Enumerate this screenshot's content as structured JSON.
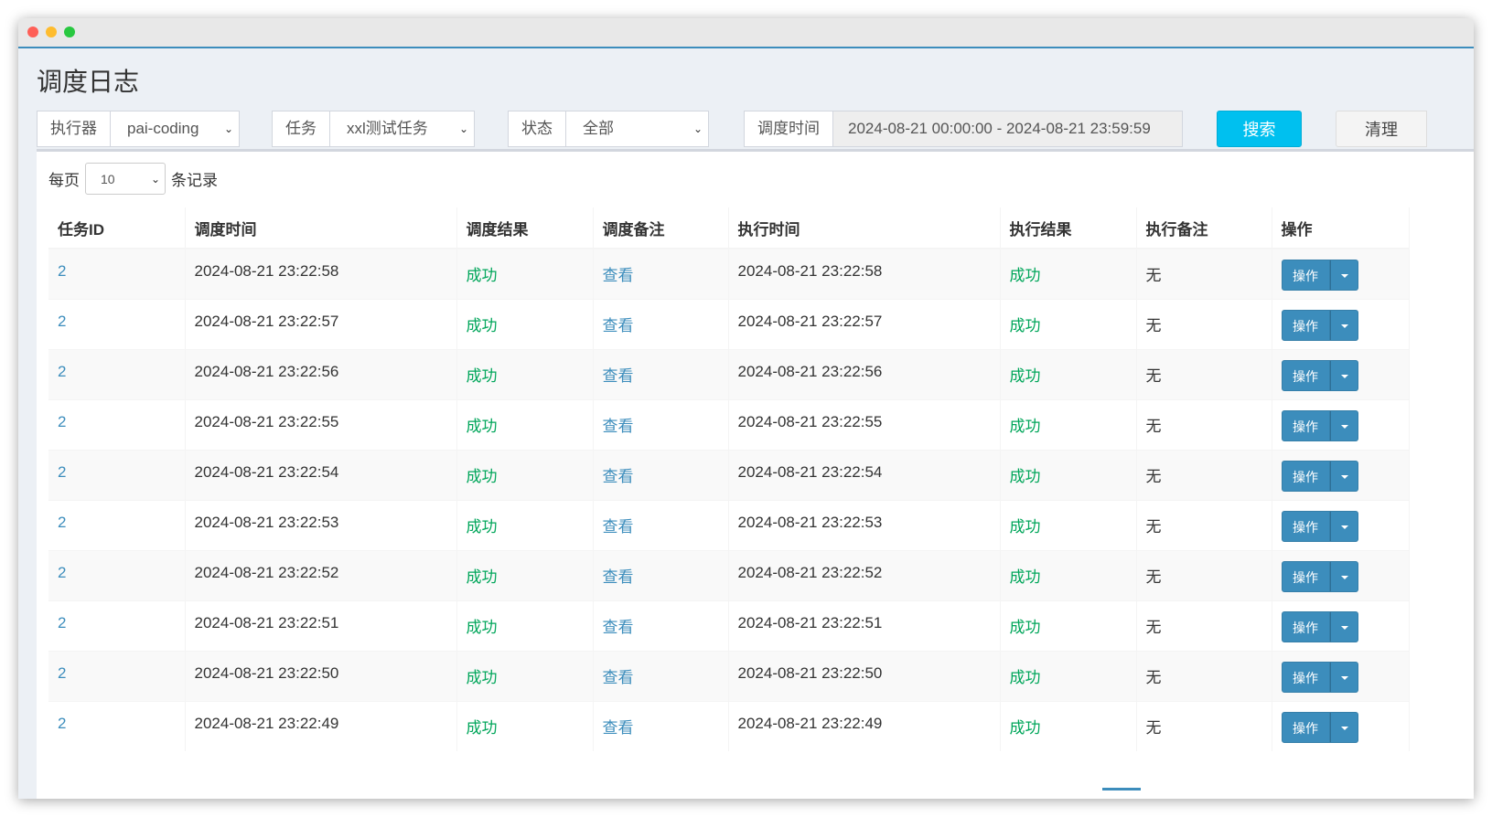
{
  "page": {
    "title": "调度日志"
  },
  "filters": {
    "executor_label": "执行器",
    "executor_value": "pai-coding",
    "job_label": "任务",
    "job_value": "xxl测试任务",
    "status_label": "状态",
    "status_value": "全部",
    "time_label": "调度时间",
    "time_value": "2024-08-21 00:00:00 - 2024-08-21 23:59:59",
    "search_label": "搜索",
    "clear_label": "清理"
  },
  "length": {
    "prefix": "每页",
    "value": "10",
    "suffix": "条记录"
  },
  "table": {
    "headers": [
      "任务ID",
      "调度时间",
      "调度结果",
      "调度备注",
      "执行时间",
      "执行结果",
      "执行备注",
      "操作"
    ],
    "rows": [
      {
        "job_id": "2",
        "trigger_time": "2024-08-21 23:22:58",
        "trigger_result": "成功",
        "trigger_note": "查看",
        "handle_time": "2024-08-21 23:22:58",
        "handle_result": "成功",
        "handle_note": "无",
        "op": "操作"
      },
      {
        "job_id": "2",
        "trigger_time": "2024-08-21 23:22:57",
        "trigger_result": "成功",
        "trigger_note": "查看",
        "handle_time": "2024-08-21 23:22:57",
        "handle_result": "成功",
        "handle_note": "无",
        "op": "操作"
      },
      {
        "job_id": "2",
        "trigger_time": "2024-08-21 23:22:56",
        "trigger_result": "成功",
        "trigger_note": "查看",
        "handle_time": "2024-08-21 23:22:56",
        "handle_result": "成功",
        "handle_note": "无",
        "op": "操作"
      },
      {
        "job_id": "2",
        "trigger_time": "2024-08-21 23:22:55",
        "trigger_result": "成功",
        "trigger_note": "查看",
        "handle_time": "2024-08-21 23:22:55",
        "handle_result": "成功",
        "handle_note": "无",
        "op": "操作"
      },
      {
        "job_id": "2",
        "trigger_time": "2024-08-21 23:22:54",
        "trigger_result": "成功",
        "trigger_note": "查看",
        "handle_time": "2024-08-21 23:22:54",
        "handle_result": "成功",
        "handle_note": "无",
        "op": "操作"
      },
      {
        "job_id": "2",
        "trigger_time": "2024-08-21 23:22:53",
        "trigger_result": "成功",
        "trigger_note": "查看",
        "handle_time": "2024-08-21 23:22:53",
        "handle_result": "成功",
        "handle_note": "无",
        "op": "操作"
      },
      {
        "job_id": "2",
        "trigger_time": "2024-08-21 23:22:52",
        "trigger_result": "成功",
        "trigger_note": "查看",
        "handle_time": "2024-08-21 23:22:52",
        "handle_result": "成功",
        "handle_note": "无",
        "op": "操作"
      },
      {
        "job_id": "2",
        "trigger_time": "2024-08-21 23:22:51",
        "trigger_result": "成功",
        "trigger_note": "查看",
        "handle_time": "2024-08-21 23:22:51",
        "handle_result": "成功",
        "handle_note": "无",
        "op": "操作"
      },
      {
        "job_id": "2",
        "trigger_time": "2024-08-21 23:22:50",
        "trigger_result": "成功",
        "trigger_note": "查看",
        "handle_time": "2024-08-21 23:22:50",
        "handle_result": "成功",
        "handle_note": "无",
        "op": "操作"
      },
      {
        "job_id": "2",
        "trigger_time": "2024-08-21 23:22:49",
        "trigger_result": "成功",
        "trigger_note": "查看",
        "handle_time": "2024-08-21 23:22:49",
        "handle_result": "成功",
        "handle_note": "无",
        "op": "操作"
      }
    ]
  },
  "colors": {
    "accent": "#3c8dbc",
    "success": "#00a65a",
    "search_button": "#00c0ef"
  }
}
